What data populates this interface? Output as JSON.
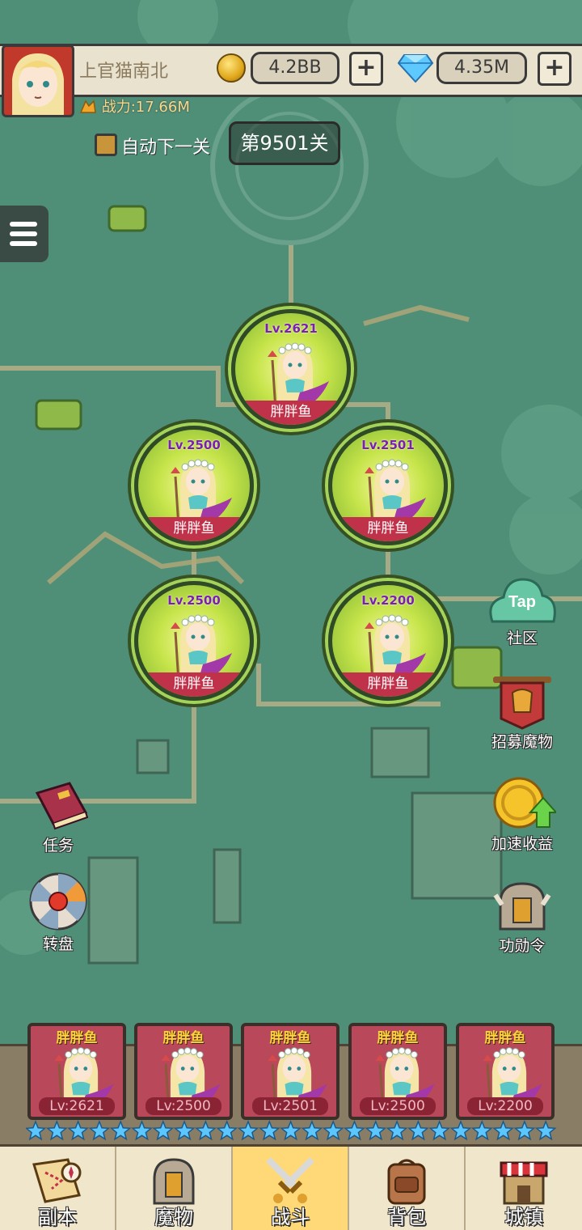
{
  "header": {
    "player_name": "上官猫南北",
    "gold": "4.2BB",
    "diamonds": "4.35M",
    "power": "战力:17.66M",
    "auto_next_label": "自动下一关",
    "stage": "第9501关"
  },
  "battle_formation": [
    {
      "name": "胖胖鱼",
      "level": "Lv.2621"
    },
    {
      "name": "胖胖鱼",
      "level": "Lv.2500"
    },
    {
      "name": "胖胖鱼",
      "level": "Lv.2501"
    },
    {
      "name": "胖胖鱼",
      "level": "Lv.2500"
    },
    {
      "name": "胖胖鱼",
      "level": "Lv.2200"
    }
  ],
  "side_buttons": {
    "community": "社区",
    "tap_badge": "Tap",
    "recruit": "招募魔物",
    "speed_income": "加速收益",
    "medal": "功勋令",
    "quest": "任务",
    "wheel": "转盘"
  },
  "team_cards": [
    {
      "name": "胖胖鱼",
      "level": "Lv:2621"
    },
    {
      "name": "胖胖鱼",
      "level": "Lv:2500"
    },
    {
      "name": "胖胖鱼",
      "level": "Lv:2501"
    },
    {
      "name": "胖胖鱼",
      "level": "Lv:2500"
    },
    {
      "name": "胖胖鱼",
      "level": "Lv:2200"
    }
  ],
  "nav": [
    {
      "label": "副本",
      "icon": "map-scroll-icon"
    },
    {
      "label": "魔物",
      "icon": "monster-helmet-icon"
    },
    {
      "label": "战斗",
      "icon": "crossed-swords-icon",
      "active": true
    },
    {
      "label": "背包",
      "icon": "backpack-icon"
    },
    {
      "label": "城镇",
      "icon": "town-shop-icon"
    }
  ],
  "colors": {
    "map_green": "#4f8f78",
    "monster_ring": "#a5d35a",
    "name_ribbon": "#c0324a",
    "nav_active": "#ffd977",
    "star_blue": "#5cc6ff"
  }
}
